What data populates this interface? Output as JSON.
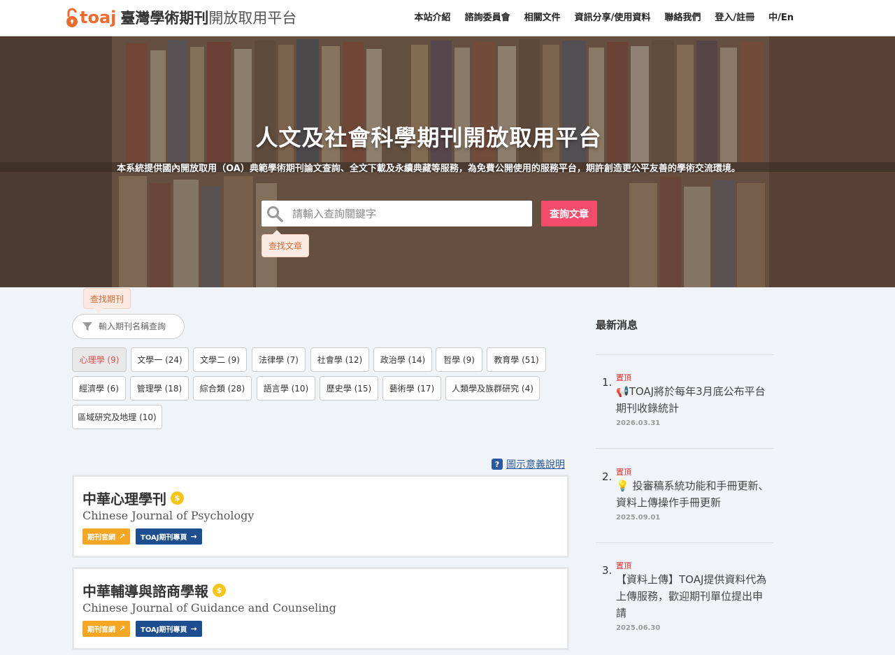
{
  "header": {
    "logo_text": "toaj",
    "site_name_bold": "臺灣學術期刊",
    "site_name_light": "開放取用平台",
    "nav": [
      "本站介紹",
      "諮詢委員會",
      "相關文件",
      "資訊分享/使用資料",
      "聯絡我們",
      "登入/註冊",
      "中/En"
    ]
  },
  "hero": {
    "title": "人文及社會科學期刊開放取用平台",
    "subtitle": "本系統提供國內開放取用（OA）典範學術期刊論文查詢、全文下載及永續典藏等服務，為免費公開使用的服務平台，期許創造更公平友善的學術交流環境。",
    "search_placeholder": "請輸入查詢關鍵字",
    "search_button": "查詢文章",
    "tooltip_articles": "查找文章"
  },
  "journal_filter": {
    "tooltip": "查找期刊",
    "placeholder": "輸入期刊名稱查詢"
  },
  "categories": [
    {
      "label": "心理學 (9)",
      "active": true
    },
    {
      "label": "文學一 (24)"
    },
    {
      "label": "文學二 (9)"
    },
    {
      "label": "法律學 (7)"
    },
    {
      "label": "社會學 (12)"
    },
    {
      "label": "政治學 (14)"
    },
    {
      "label": "哲學 (9)"
    },
    {
      "label": "教育學 (51)"
    },
    {
      "label": "經濟學 (6)"
    },
    {
      "label": "管理學 (18)"
    },
    {
      "label": "綜合類 (28)"
    },
    {
      "label": "語言學 (10)"
    },
    {
      "label": "歷史學 (15)"
    },
    {
      "label": "藝術學 (17)"
    },
    {
      "label": "人類學及族群研究 (4)"
    },
    {
      "label": "區域研究及地理 (10)"
    }
  ],
  "legend_link": "圖示意義說明",
  "journals": [
    {
      "title": "中華心理學刊",
      "en": "Chinese Journal of Psychology",
      "official": "期刊官網",
      "toaj": "TOAJ期刊專頁"
    },
    {
      "title": "中華輔導與諮商學報",
      "en": "Chinese Journal of Guidance and Counseling",
      "official": "期刊官網",
      "toaj": "TOAJ期刊專頁"
    }
  ],
  "news": {
    "heading": "最新消息",
    "items": [
      {
        "num": "1.",
        "pin": "置頂",
        "icon": "megaphone-icon",
        "text": "TOAJ將於每年3月底公布平台期刊收錄統計",
        "date": "2026.03.31"
      },
      {
        "num": "2.",
        "pin": "置頂",
        "icon": "lightbulb-icon",
        "text": "投審稿系統功能和手冊更新、資料上傳操作手冊更新",
        "date": "2025.09.01"
      },
      {
        "num": "3.",
        "pin": "置頂",
        "icon": "",
        "text": "【資料上傳】TOAJ提供資料代為上傳服務，歡迎期刊單位提出申請",
        "date": "2025.06.30"
      }
    ]
  },
  "colors": {
    "brand_orange": "#f06a2b",
    "search_button": "#f44d6b",
    "official_button": "#f5a623",
    "toaj_button": "#1d4e8f",
    "pin_red": "#e03030"
  }
}
